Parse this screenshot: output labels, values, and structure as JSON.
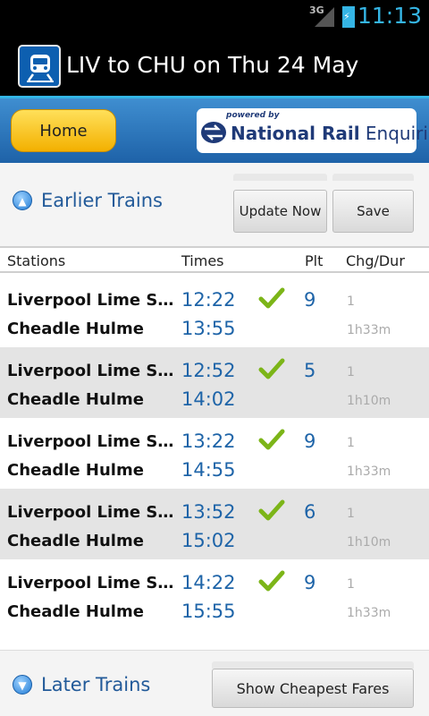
{
  "status_bar": {
    "network": "3G",
    "time": "11:13"
  },
  "action_bar": {
    "title": "LIV to CHU on Thu 24 May",
    "icon": "train-icon"
  },
  "header": {
    "home_label": "Home",
    "brand_powered": "powered by",
    "brand_name_bold": "National Rail",
    "brand_name_light": "Enquiries"
  },
  "toolbar": {
    "earlier_label": "Earlier Trains",
    "update_label": "Update Now",
    "save_label": "Save"
  },
  "columns": [
    "Stations",
    "Times",
    "Plt",
    "Chg/Dur"
  ],
  "journeys": [
    {
      "from": "Liverpool Lime Street",
      "to": "Cheadle Hulme",
      "depart": "12:22",
      "arrive": "13:55",
      "on_time": true,
      "platform": "9",
      "changes": "1",
      "duration": "1h33m"
    },
    {
      "from": "Liverpool Lime Street",
      "to": "Cheadle Hulme",
      "depart": "12:52",
      "arrive": "14:02",
      "on_time": true,
      "platform": "5",
      "changes": "1",
      "duration": "1h10m"
    },
    {
      "from": "Liverpool Lime Street",
      "to": "Cheadle Hulme",
      "depart": "13:22",
      "arrive": "14:55",
      "on_time": true,
      "platform": "9",
      "changes": "1",
      "duration": "1h33m"
    },
    {
      "from": "Liverpool Lime Street",
      "to": "Cheadle Hulme",
      "depart": "13:52",
      "arrive": "15:02",
      "on_time": true,
      "platform": "6",
      "changes": "1",
      "duration": "1h10m"
    },
    {
      "from": "Liverpool Lime Street",
      "to": "Cheadle Hulme",
      "depart": "14:22",
      "arrive": "15:55",
      "on_time": true,
      "platform": "9",
      "changes": "1",
      "duration": "1h33m"
    }
  ],
  "bottom": {
    "later_label": "Later Trains",
    "fares_label": "Show Cheapest Fares"
  },
  "colors": {
    "accent": "#33b5e5",
    "time_blue": "#1e64a8",
    "home_yellow": "#f3b000",
    "check_green": "#7cb518"
  }
}
